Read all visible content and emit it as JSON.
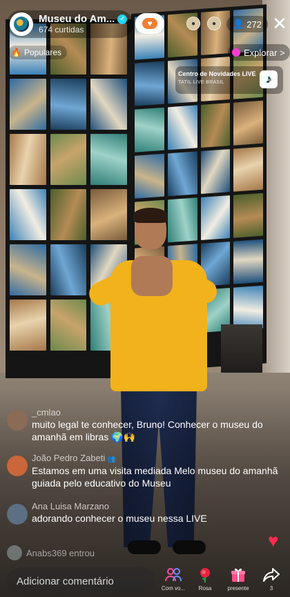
{
  "host": {
    "name": "Museu do Am...",
    "likes": "674 curtidas"
  },
  "header": {
    "viewer_count": "272",
    "close_glyph": "✕"
  },
  "badges": {
    "popular": "Populares",
    "explorar": "Explorar >"
  },
  "live_card": {
    "title": "Centro de Novidades LIVE",
    "subtitle": "TATIL LIVE BRASIL"
  },
  "comments": [
    {
      "user": "_cmlao",
      "text": "muito legal te conhecer, Bruno! Conhecer o museu do amanhã em libras 🌍🙌",
      "avatar_color": "#8a6b55"
    },
    {
      "user": "João Pedro Zabeti",
      "text": "Estamos em uma visita mediada Melo museu do amanhã guiada pelo educativo do Museu",
      "avatar_color": "#c9663a"
    },
    {
      "user": "Ana Luisa Marzano",
      "text": "adorando conhecer o museu nessa LIVE",
      "avatar_color": "#5d6f83"
    }
  ],
  "joined_text": "Anabs369 entrou",
  "bottom_bar": {
    "comment_placeholder": "Adicionar comentário",
    "actions": [
      {
        "label": "Com vo...",
        "icon": "group-icon"
      },
      {
        "label": "Rosa",
        "icon": "rose-icon"
      },
      {
        "label": "presente",
        "icon": "gift-icon"
      },
      {
        "label": "3",
        "icon": "share-icon"
      }
    ]
  },
  "colors": {
    "verified": "#20d5ec",
    "follow_accent": "#f07f35",
    "shirt": "#f2b21b",
    "explore_dot": "#ff3bd4",
    "heart": "#ff2b4f"
  }
}
